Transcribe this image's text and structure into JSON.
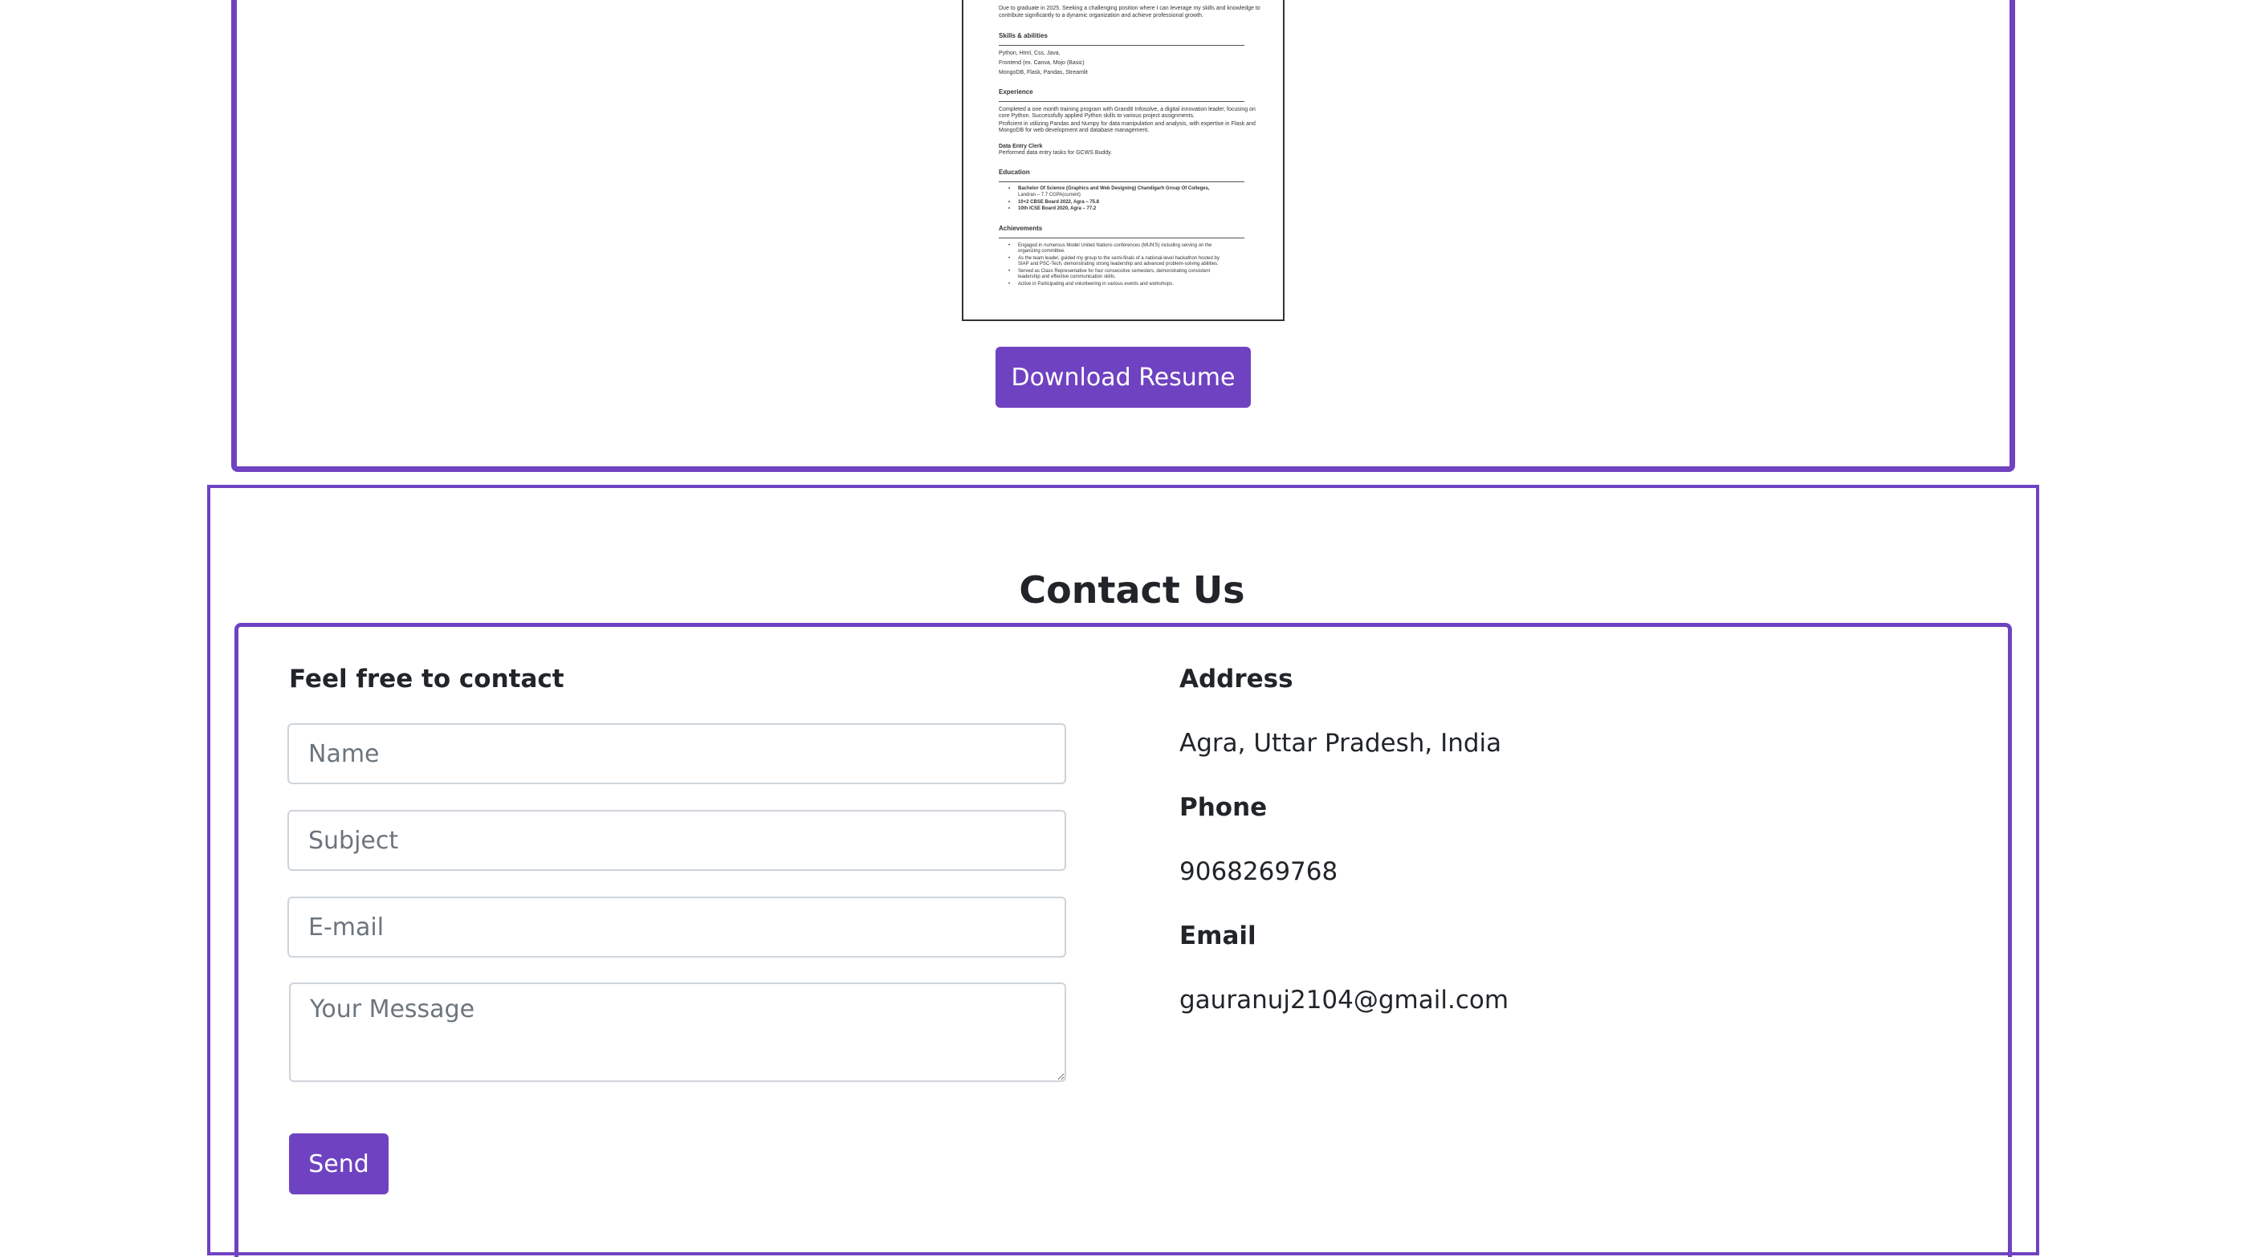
{
  "resume": {
    "objective": [
      "Due to graduate in 2025. Seeking a challenging position where I can leverage my skills and knowledge to",
      "contribute significantly to a dynamic organization and achieve professional growth."
    ],
    "skills_heading": "Skills & abilities",
    "skills": [
      "Python, Html, Css, Java,",
      "Frontend (ex. Canva, Mojo (Basic)",
      "MongoDB, Flask, Pandas, Streamlit"
    ],
    "experience_heading": "Experience",
    "experience": [
      "Completed a one month training program with Grand8 Infosolve, a digital innovation leader, focusing on",
      "core Python. Successfully applied Python skills to various project assignments.",
      "Proficient in utilizing Pandas and Numpy for data manipulation and analysis, with expertise in Flask and",
      "MongoDB for web development and database management."
    ],
    "job_title": "Data Entry Clerk",
    "job_desc": "Performed data entry tasks for GCWS Buddy.",
    "education_heading": "Education",
    "education": [
      "Bachelor Of Science (Graphics and Web Designing) Chandigarh Group Of Colleges,",
      "Landran – 7.7 CGPA(current)",
      "10+2 CBSE Board 2022, Agra – 75.8",
      "10th ICSE Board 2020, Agra – 77.2"
    ],
    "achievements_heading": "Achievements",
    "achievements": [
      "Engaged in numerous Model United Nations conferences (MUN'S) including serving on the",
      "organizing committee.",
      "As the team leader, guided my group to the semi-finals of a national-level hackathon hosted by",
      "SIAP and PSC-Tech, demonstrating strong leadership and advanced problem-solving abilities.",
      "Served as Class Representative for four consecutive semesters, demonstrating consistent",
      "leadership and effective communication skills.",
      "Active in Participating and volunteering in various events and workshops."
    ],
    "download_label": "Download Resume"
  },
  "contact": {
    "title": "Contact Us",
    "form_heading": "Feel free to contact",
    "name_placeholder": "Name",
    "subject_placeholder": "Subject",
    "email_placeholder": "E-mail",
    "message_placeholder": "Your Message",
    "send_label": "Send",
    "address_label": "Address",
    "address_value": "Agra, Uttar Pradesh, India",
    "phone_label": "Phone",
    "phone_value": "9068269768",
    "email_label": "Email",
    "email_value": "gauranuj2104@gmail.com"
  },
  "colors": {
    "accent": "#6f42c1",
    "text": "#212529",
    "placeholder": "#6c757d",
    "input_border": "#ced4da"
  }
}
